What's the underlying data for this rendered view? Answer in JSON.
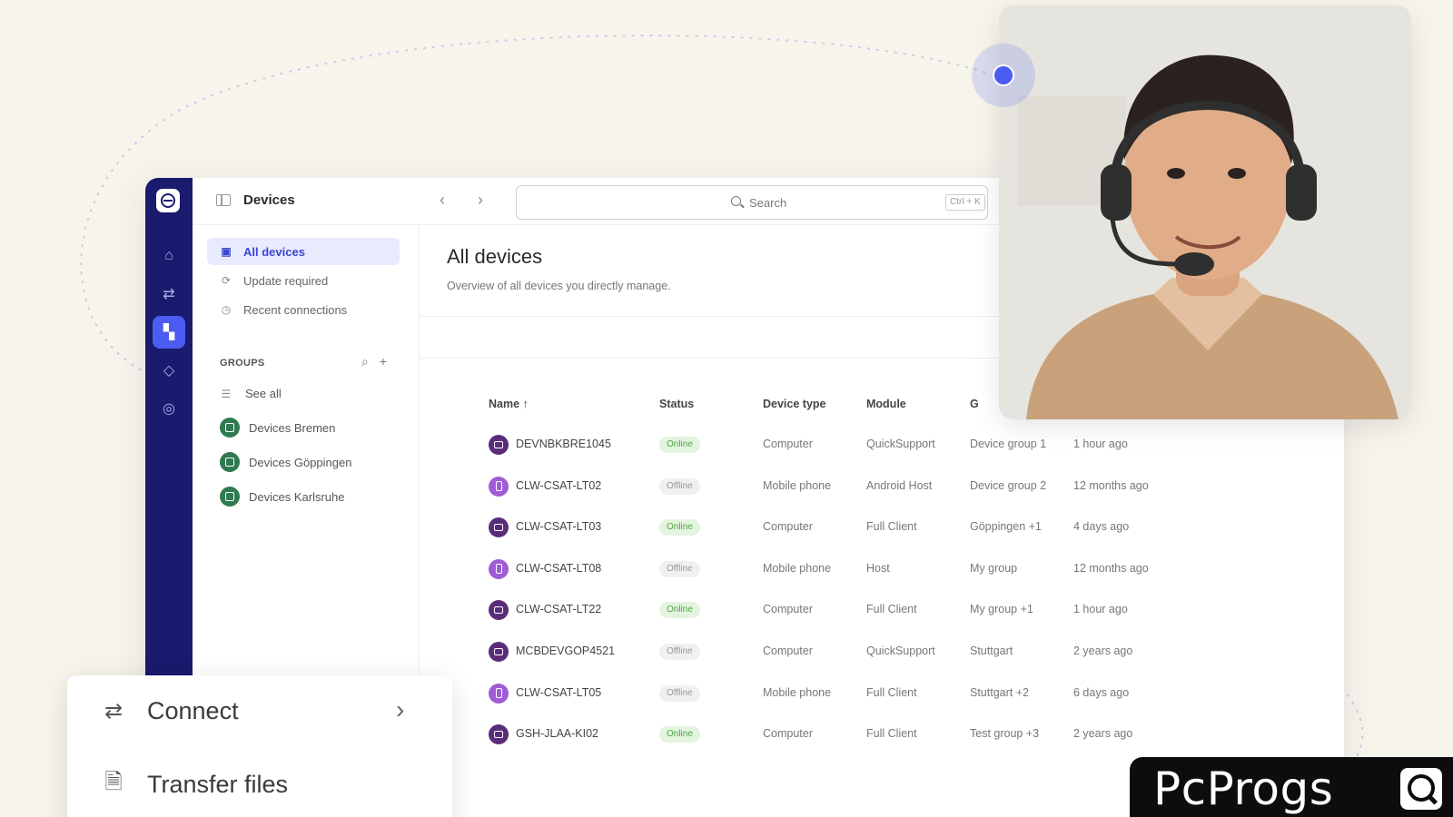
{
  "app": {
    "title": "Devices",
    "search_placeholder": "Search",
    "search_shortcut": "Ctrl + K"
  },
  "rail": {
    "items": [
      {
        "icon": "home-icon"
      },
      {
        "icon": "connect-arrows-icon"
      },
      {
        "icon": "devices-icon",
        "active": true
      },
      {
        "icon": "diamond-icon"
      },
      {
        "icon": "settings-icon"
      }
    ]
  },
  "sidebar": {
    "items": [
      {
        "label": "All devices",
        "active": true
      },
      {
        "label": "Update required"
      },
      {
        "label": "Recent connections"
      }
    ],
    "groups_heading": "GROUPS",
    "see_all": "See all",
    "groups": [
      {
        "label": "Devices Bremen"
      },
      {
        "label": "Devices Göppingen"
      },
      {
        "label": "Devices Karlsruhe"
      }
    ]
  },
  "main": {
    "title": "All devices",
    "subtitle": "Overview of all devices you directly manage.",
    "columns": [
      "Name ↑",
      "Status",
      "Device type",
      "Module",
      "G"
    ],
    "rows": [
      {
        "name": "DEVNBKBRE1045",
        "status": "Online",
        "type": "Computer",
        "module": "QuickSupport",
        "group": "Device group 1",
        "last": "1 hour ago",
        "icon": "computer"
      },
      {
        "name": "CLW-CSAT-LT02",
        "status": "Offline",
        "type": "Mobile phone",
        "module": "Android Host",
        "group": "Device group 2",
        "last": "12 months ago",
        "icon": "phone"
      },
      {
        "name": "CLW-CSAT-LT03",
        "status": "Online",
        "type": "Computer",
        "module": "Full Client",
        "group": "Göppingen +1",
        "last": "4 days ago",
        "icon": "computer"
      },
      {
        "name": "CLW-CSAT-LT08",
        "status": "Offline",
        "type": "Mobile phone",
        "module": "Host",
        "group": "My group",
        "last": "12 months ago",
        "icon": "phone"
      },
      {
        "name": "CLW-CSAT-LT22",
        "status": "Online",
        "type": "Computer",
        "module": "Full Client",
        "group": "My group +1",
        "last": "1 hour ago",
        "icon": "computer"
      },
      {
        "name": "MCBDEVGOP4521",
        "status": "Offline",
        "type": "Computer",
        "module": "QuickSupport",
        "group": "Stuttgart",
        "last": "2 years ago",
        "icon": "computer"
      },
      {
        "name": "CLW-CSAT-LT05",
        "status": "Offline",
        "type": "Mobile phone",
        "module": "Full Client",
        "group": "Stuttgart +2",
        "last": "6 days ago",
        "icon": "phone"
      },
      {
        "name": "GSH-JLAA-KI02",
        "status": "Online",
        "type": "Computer",
        "module": "Full Client",
        "group": "Test group +3",
        "last": "2 years ago",
        "icon": "computer"
      }
    ]
  },
  "actions": {
    "connect": "Connect",
    "transfer": "Transfer files"
  },
  "watermark": {
    "text": "PcProgs"
  },
  "colors": {
    "rail": "#1a1a6e",
    "accent": "#4b5cf0",
    "online": "#55a349",
    "group_dot": "#2f7a4f",
    "computer_icon": "#5a2d7a",
    "phone_icon": "#a05cd6"
  }
}
